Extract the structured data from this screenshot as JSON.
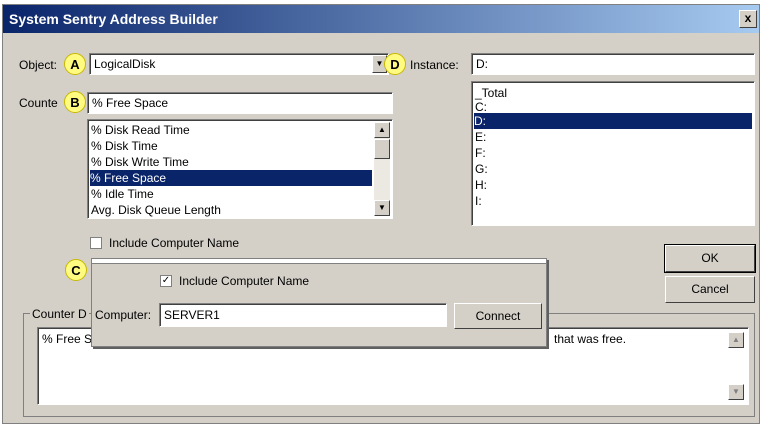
{
  "window": {
    "title": "System Sentry Address Builder",
    "close_glyph": "x"
  },
  "object": {
    "label": "Object:",
    "value": "LogicalDisk"
  },
  "instance": {
    "label": "Instance:",
    "value": "D:",
    "items": [
      "_Total",
      "C:",
      "D:",
      "E:",
      "F:",
      "G:",
      "H:",
      "I:"
    ],
    "selected_index": 2
  },
  "counter": {
    "label": "Counte",
    "value": "% Free Space",
    "items": [
      "% Disk Read Time",
      "% Disk Time",
      "% Disk Write Time",
      "% Free Space",
      "% Idle Time",
      "Avg. Disk Queue Length"
    ],
    "selected_index": 3
  },
  "include_computer": {
    "label": "Include Computer Name",
    "checked": false
  },
  "callouts": {
    "a": "A",
    "b": "B",
    "c": "C",
    "d": "D"
  },
  "buttons": {
    "ok": "OK",
    "cancel": "Cancel"
  },
  "popup": {
    "include_label": "Include Computer Name",
    "include_checked": true,
    "computer_label": "Computer:",
    "computer_value": "SERVER1",
    "connect_label": "Connect"
  },
  "counter_desc": {
    "group_label": "Counter D",
    "text_start": "% Free S",
    "text_end": "that was free."
  },
  "colors": {
    "title_bar": "#0a246a",
    "selection": "#0a246a",
    "callout": "#fffa80"
  }
}
